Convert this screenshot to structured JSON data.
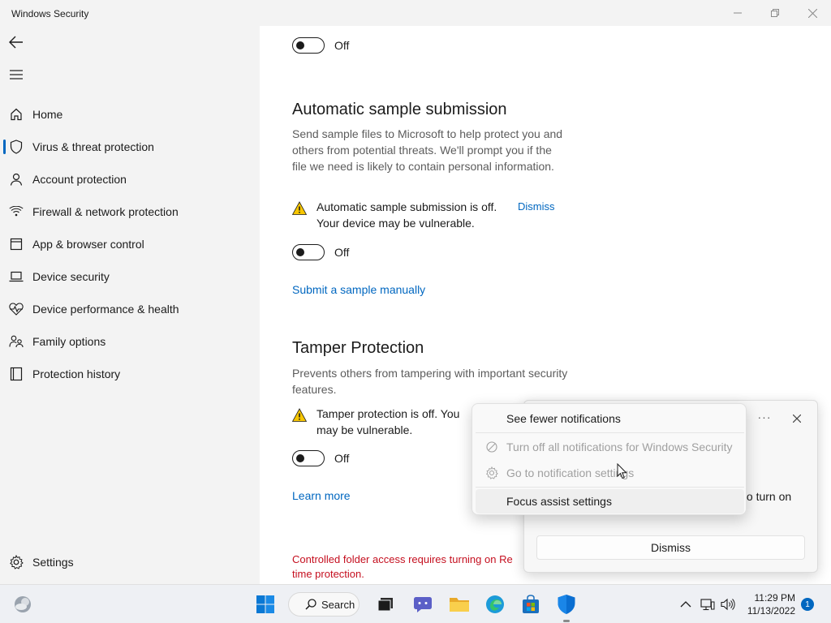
{
  "window": {
    "title": "Windows Security"
  },
  "sidebar": {
    "items": [
      {
        "label": "Home",
        "icon": "home-icon"
      },
      {
        "label": "Virus & threat protection",
        "icon": "shield-icon",
        "active": true
      },
      {
        "label": "Account protection",
        "icon": "person-icon"
      },
      {
        "label": "Firewall & network protection",
        "icon": "wifi-icon"
      },
      {
        "label": "App & browser control",
        "icon": "app-window-icon"
      },
      {
        "label": "Device security",
        "icon": "laptop-icon"
      },
      {
        "label": "Device performance & health",
        "icon": "heart-icon"
      },
      {
        "label": "Family options",
        "icon": "family-icon"
      },
      {
        "label": "Protection history",
        "icon": "history-icon"
      }
    ],
    "settings_label": "Settings"
  },
  "main": {
    "top_toggle": {
      "state": "Off"
    },
    "sample": {
      "heading": "Automatic sample submission",
      "description": "Send sample files to Microsoft to help protect you and others from potential threats. We'll prompt you if the file we need is likely to contain personal information.",
      "warning_line1": "Automatic sample submission is off.",
      "warning_line2": "Your device may be vulnerable.",
      "dismiss": "Dismiss",
      "toggle_state": "Off",
      "link": "Submit a sample manually"
    },
    "tamper": {
      "heading": "Tamper Protection",
      "description": "Prevents others from tampering with important security features.",
      "warning_line1": "Tamper protection is off. You",
      "warning_line2": "may be vulnerable.",
      "toggle_state": "Off",
      "link": "Learn more"
    },
    "controlled_folder_line1": "Controlled folder access requires turning on Re",
    "controlled_folder_line2": "time protection."
  },
  "toast": {
    "partial_text": "to turn on",
    "dismiss": "Dismiss",
    "more": "···"
  },
  "context_menu": {
    "items": [
      {
        "label": "See fewer notifications",
        "disabled": false
      },
      {
        "label": "Turn off all notifications for Windows Security",
        "disabled": true,
        "icon": "blocked-icon"
      },
      {
        "label": "Go to notification settings",
        "disabled": true,
        "icon": "gear-icon"
      },
      {
        "label": "Focus assist settings",
        "disabled": false
      }
    ]
  },
  "taskbar": {
    "search_label": "Search",
    "time": "11:29 PM",
    "date": "11/13/2022",
    "notification_count": "1"
  },
  "colors": {
    "accent": "#0067c0",
    "error": "#c50f1f",
    "warning": "#f7c600"
  }
}
